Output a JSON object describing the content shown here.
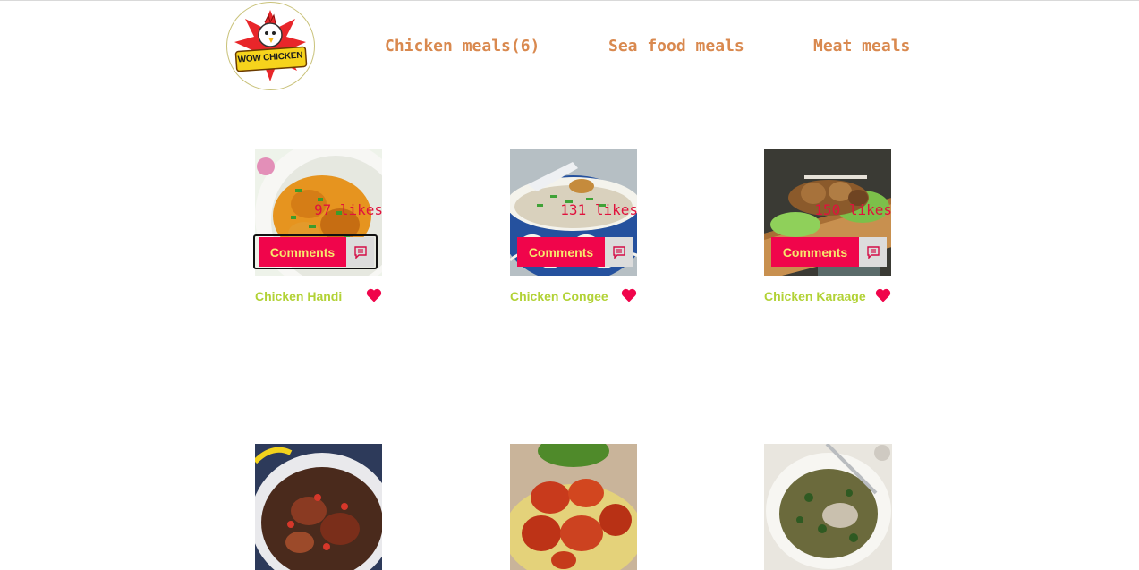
{
  "logo": {
    "alt": "Wow Chicken logo",
    "text": "WOW CHICKEN"
  },
  "nav": [
    {
      "label": "Chicken meals(6)",
      "active": true
    },
    {
      "label": "Sea food meals",
      "active": false
    },
    {
      "label": "Meat meals",
      "active": false
    }
  ],
  "meals": [
    {
      "name": "Chicken Handi",
      "likes": "97 likes",
      "comments_label": "Comments",
      "image_icon": "chicken-handi-photo"
    },
    {
      "name": "Chicken Congee",
      "likes": "131 likes",
      "comments_label": "Comments",
      "image_icon": "chicken-congee-photo"
    },
    {
      "name": "Chicken Karaage",
      "likes": "150 likes",
      "comments_label": "Comments",
      "image_icon": "chicken-karaage-photo"
    },
    {
      "name": "",
      "likes": "",
      "comments_label": "",
      "image_icon": "chicken-stew-photo"
    },
    {
      "name": "",
      "likes": "",
      "comments_label": "",
      "image_icon": "tandoori-chicken-photo"
    },
    {
      "name": "",
      "likes": "",
      "comments_label": "",
      "image_icon": "chicken-grain-bowl-photo"
    }
  ],
  "colors": {
    "nav_text": "#d9894f",
    "meal_name": "#b2d236",
    "heart": "#f0054b",
    "likes": "#e0123d",
    "comments_bg": "#f0054b",
    "comments_text": "#f7e66d",
    "comments_icon_bg": "#dcdcdc"
  }
}
